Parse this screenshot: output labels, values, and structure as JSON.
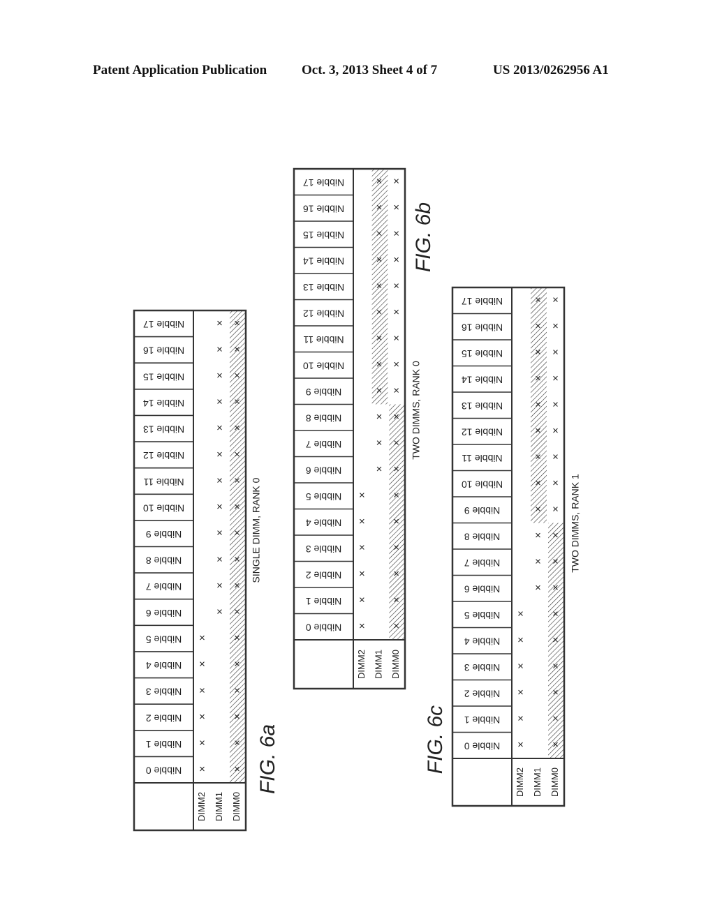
{
  "header": {
    "left": "Patent Application Publication",
    "middle": "Oct. 3, 2013    Sheet 4 of 7",
    "right": "US 2013/0262956 A1"
  },
  "figures": [
    {
      "id": "6a",
      "label": "FIG. 6a",
      "caption": "SINGLE DIMM, RANK 0",
      "dimm_columns": [
        "DIMM2",
        "DIMM1",
        "DIMM0"
      ],
      "nibbles": [
        "Nibble 0",
        "Nibble 1",
        "Nibble 2",
        "Nibble 3",
        "Nibble 4",
        "Nibble 5",
        "Nibble 6",
        "Nibble 7",
        "Nibble 8",
        "Nibble 9",
        "Nibble 10",
        "Nibble 11",
        "Nibble 12",
        "Nibble 13",
        "Nibble 14",
        "Nibble 15",
        "Nibble 16",
        "Nibble 17"
      ],
      "marks": {
        "DIMM2": [
          1,
          1,
          1,
          1,
          1,
          1,
          0,
          0,
          0,
          0,
          0,
          0,
          0,
          0,
          0,
          0,
          0,
          0
        ],
        "DIMM1": [
          0,
          0,
          0,
          0,
          0,
          0,
          1,
          1,
          1,
          1,
          1,
          1,
          1,
          1,
          1,
          1,
          1,
          1
        ],
        "DIMM0": [
          1,
          1,
          1,
          1,
          1,
          1,
          1,
          1,
          1,
          1,
          1,
          1,
          1,
          1,
          1,
          1,
          1,
          1
        ]
      },
      "hatched": {
        "DIMM2": [
          0,
          0,
          0,
          0,
          0,
          0,
          0,
          0,
          0,
          0,
          0,
          0,
          0,
          0,
          0,
          0,
          0,
          0
        ],
        "DIMM1": [
          0,
          0,
          0,
          0,
          0,
          0,
          0,
          0,
          0,
          0,
          0,
          0,
          0,
          0,
          0,
          0,
          0,
          0
        ],
        "DIMM0": [
          1,
          1,
          1,
          1,
          1,
          1,
          1,
          1,
          1,
          1,
          1,
          1,
          1,
          1,
          1,
          1,
          1,
          1
        ]
      }
    },
    {
      "id": "6b",
      "label": "FIG. 6b",
      "caption": "TWO DIMMS, RANK 0",
      "dimm_columns": [
        "DIMM2",
        "DIMM1",
        "DIMM0"
      ],
      "nibbles": [
        "Nibble 0",
        "Nibble 1",
        "Nibble 2",
        "Nibble 3",
        "Nibble 4",
        "Nibble 5",
        "Nibble 6",
        "Nibble 7",
        "Nibble 8",
        "Nibble 9",
        "Nibble 10",
        "Nibble 11",
        "Nibble 12",
        "Nibble 13",
        "Nibble 14",
        "Nibble 15",
        "Nibble 16",
        "Nibble 17"
      ],
      "marks": {
        "DIMM2": [
          1,
          1,
          1,
          1,
          1,
          1,
          0,
          0,
          0,
          0,
          0,
          0,
          0,
          0,
          0,
          0,
          0,
          0
        ],
        "DIMM1": [
          0,
          0,
          0,
          0,
          0,
          0,
          1,
          1,
          1,
          1,
          1,
          1,
          1,
          1,
          1,
          1,
          1,
          1
        ],
        "DIMM0": [
          1,
          1,
          1,
          1,
          1,
          1,
          1,
          1,
          1,
          1,
          1,
          1,
          1,
          1,
          1,
          1,
          1,
          1
        ]
      },
      "hatched": {
        "DIMM2": [
          0,
          0,
          0,
          0,
          0,
          0,
          0,
          0,
          0,
          0,
          0,
          0,
          0,
          0,
          0,
          0,
          0,
          0
        ],
        "DIMM1": [
          0,
          0,
          0,
          0,
          0,
          0,
          0,
          0,
          0,
          1,
          1,
          1,
          1,
          1,
          1,
          1,
          1,
          1
        ],
        "DIMM0": [
          1,
          1,
          1,
          1,
          1,
          1,
          1,
          1,
          1,
          0,
          0,
          0,
          0,
          0,
          0,
          0,
          0,
          0
        ]
      }
    },
    {
      "id": "6c",
      "label": "FIG. 6c",
      "caption": "TWO DIMMS, RANK 1",
      "dimm_columns": [
        "DIMM2",
        "DIMM1",
        "DIMM0"
      ],
      "nibbles": [
        "Nibble 0",
        "Nibble 1",
        "Nibble 2",
        "Nibble 3",
        "Nibble 4",
        "Nibble 5",
        "Nibble 6",
        "Nibble 7",
        "Nibble 8",
        "Nibble 9",
        "Nibble 10",
        "Nibble 11",
        "Nibble 12",
        "Nibble 13",
        "Nibble 14",
        "Nibble 15",
        "Nibble 16",
        "Nibble 17"
      ],
      "marks": {
        "DIMM2": [
          1,
          1,
          1,
          1,
          1,
          1,
          0,
          0,
          0,
          0,
          0,
          0,
          0,
          0,
          0,
          0,
          0,
          0
        ],
        "DIMM1": [
          0,
          0,
          0,
          0,
          0,
          0,
          1,
          1,
          1,
          1,
          1,
          1,
          1,
          1,
          1,
          1,
          1,
          1
        ],
        "DIMM0": [
          1,
          1,
          1,
          1,
          1,
          1,
          1,
          1,
          1,
          1,
          1,
          1,
          1,
          1,
          1,
          1,
          1,
          1
        ]
      },
      "hatched": {
        "DIMM2": [
          0,
          0,
          0,
          0,
          0,
          0,
          0,
          0,
          0,
          0,
          0,
          0,
          0,
          0,
          0,
          0,
          0,
          0
        ],
        "DIMM1": [
          0,
          0,
          0,
          0,
          0,
          0,
          0,
          0,
          0,
          1,
          1,
          1,
          1,
          1,
          1,
          1,
          1,
          1
        ],
        "DIMM0": [
          1,
          1,
          1,
          1,
          1,
          1,
          1,
          1,
          1,
          0,
          0,
          0,
          0,
          0,
          0,
          0,
          0,
          0
        ]
      }
    }
  ],
  "mark_symbol": "×"
}
